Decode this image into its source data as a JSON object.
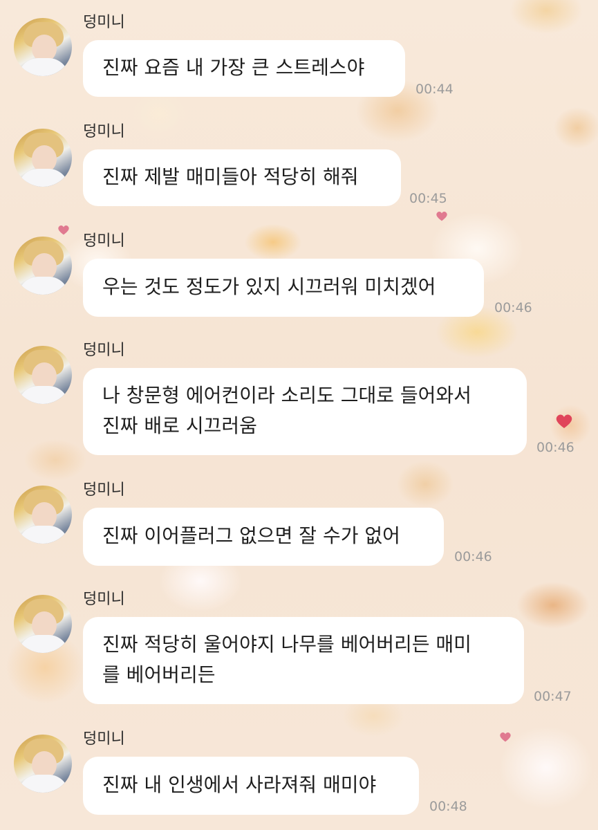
{
  "sender": {
    "name": "덩미니",
    "avatar_icon": "profile-photo"
  },
  "messages": [
    {
      "text": "진짜 요즘 내 가장 큰 스트레스야",
      "time": "00:44"
    },
    {
      "text": "진짜 제발 매미들아 적당히 해줘",
      "time": "00:45"
    },
    {
      "text": "우는 것도 정도가 있지 시끄러워 미치겠어",
      "time": "00:46"
    },
    {
      "text": "나 창문형 에어컨이라 소리도 그대로 들어와서\n진짜 배로 시끄러움",
      "time": "00:46"
    },
    {
      "text": "진짜 이어플러그 없으면 잘 수가 없어",
      "time": "00:46"
    },
    {
      "text": "진짜 적당히 울어야지 나무를 베어버리든 매미\n를 베어버리든",
      "time": "00:47"
    },
    {
      "text": "진짜 내 인생에서 사라져줘 매미야",
      "time": "00:48"
    }
  ],
  "colors": {
    "background": "#f6e6d6",
    "bubble": "#ffffff",
    "timestamp": "#9b9b9b"
  }
}
